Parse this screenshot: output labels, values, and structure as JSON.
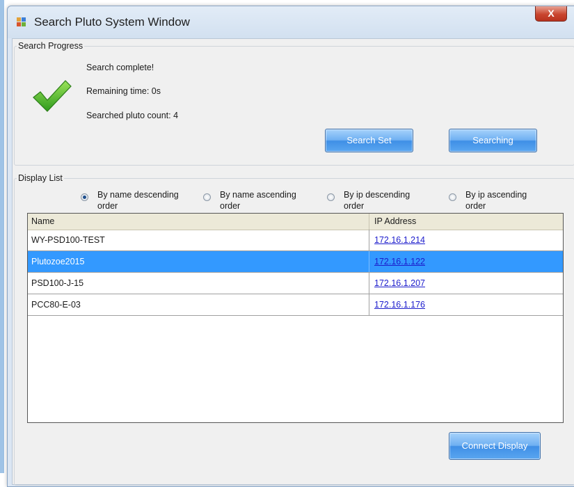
{
  "window": {
    "title": "Search Pluto System Window",
    "close_label": "X",
    "colors": {
      "accent": "#3399ff",
      "title_bg": "#dbe6f3",
      "link": "#1c1ccc"
    }
  },
  "search_progress": {
    "group_label": "Search Progress",
    "status_icon": "check-icon",
    "status": "Search complete!",
    "remaining": "Remaining time: 0s",
    "count": "Searched pluto count: 4",
    "search_set_label": "Search Set",
    "searching_label": "Searching"
  },
  "display_list": {
    "group_label": "Display List",
    "sort_options": [
      {
        "label": "By name descending order",
        "selected": true
      },
      {
        "label": "By name ascending order",
        "selected": false
      },
      {
        "label": "By ip descending order",
        "selected": false
      },
      {
        "label": "By ip ascending order",
        "selected": false
      }
    ],
    "columns": [
      "Name",
      "IP Address"
    ],
    "rows": [
      {
        "name": "WY-PSD100-TEST",
        "ip": "172.16.1.214",
        "selected": false
      },
      {
        "name": "Plutozoe2015",
        "ip": "172.16.1.122",
        "selected": true
      },
      {
        "name": "PSD100-J-15",
        "ip": "172.16.1.207",
        "selected": false
      },
      {
        "name": "PCC80-E-03",
        "ip": "172.16.1.176",
        "selected": false
      }
    ],
    "connect_label": "Connect Display"
  }
}
